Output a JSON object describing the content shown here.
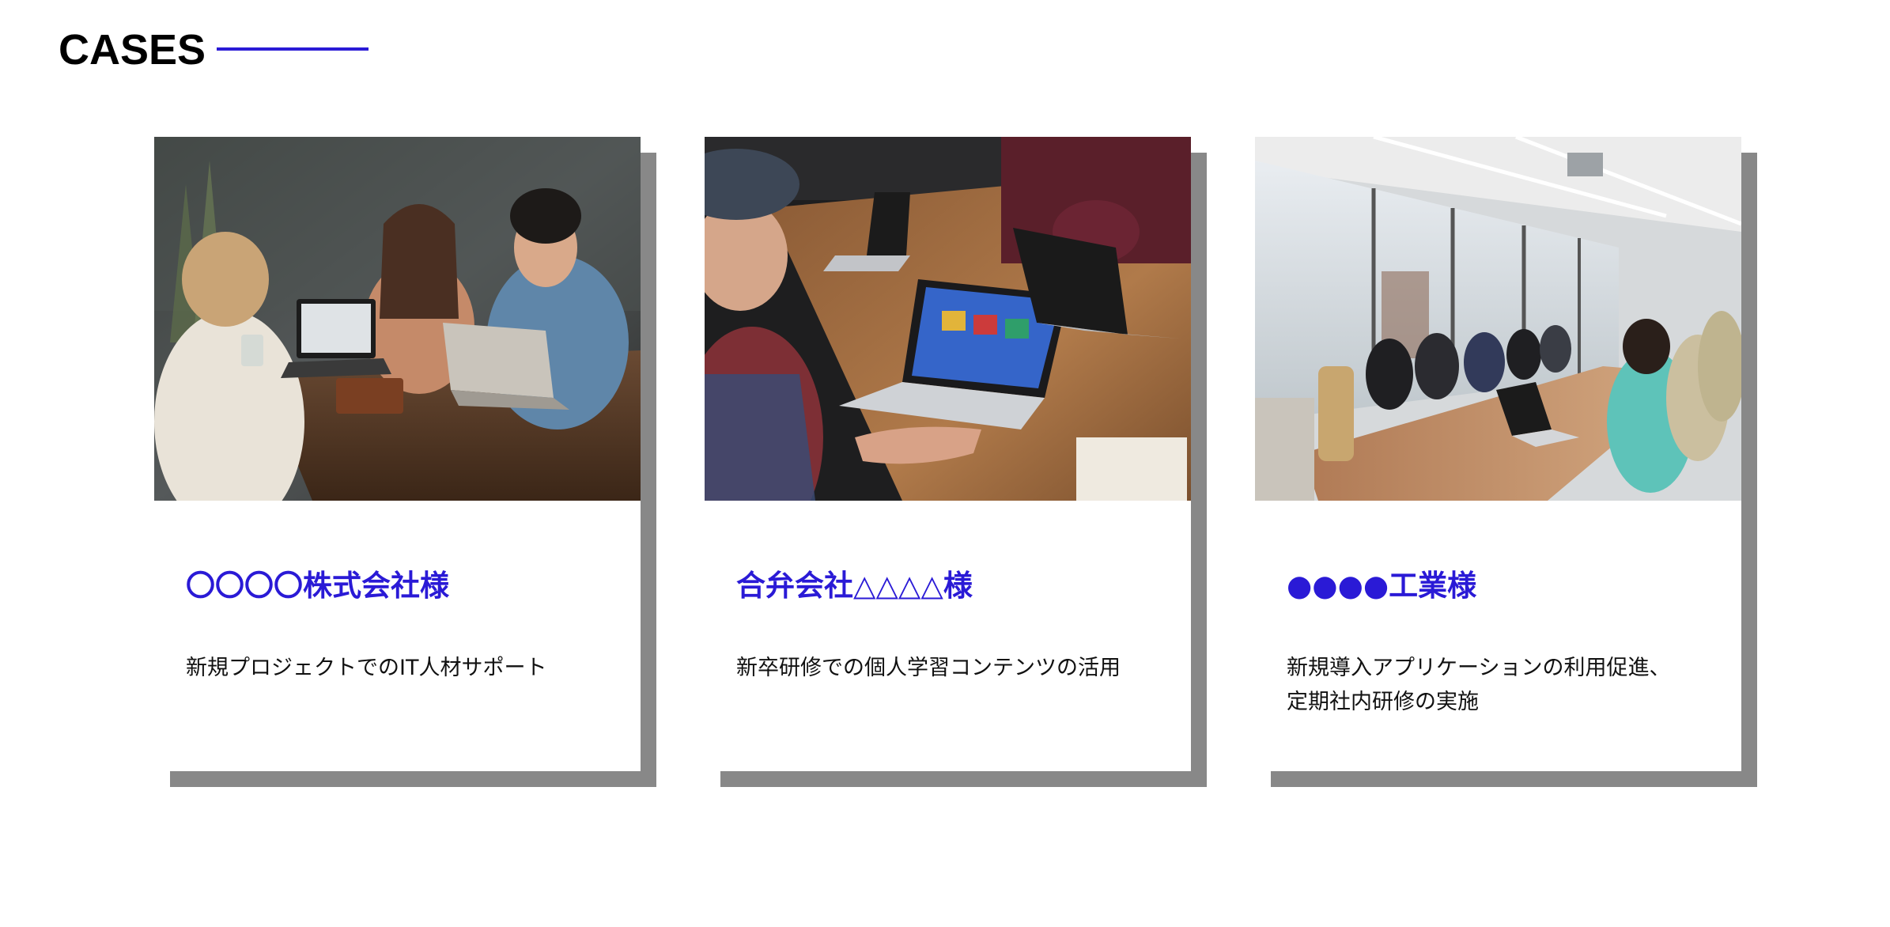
{
  "header": {
    "title": "CASES"
  },
  "theme": {
    "accent": "#2a1ad6",
    "shadow": "#888888"
  },
  "cases": [
    {
      "name": "〇〇〇〇株式会社様",
      "description_lines": [
        "新規プロジェクトでのIT人材サポート"
      ],
      "photo": "people-laughing-at-cafe-table-with-laptops"
    },
    {
      "name": "合弁会社△△△△様",
      "description_lines": [
        "新卒研修での個人学習コンテンツの活用"
      ],
      "photo": "meeting-table-with-laptops-overhead"
    },
    {
      "name": "●●●●工業様",
      "description_lines": [
        "新規導入アプリケーションの利用促進、",
        "定期社内研修の実施"
      ],
      "photo": "large-conference-room-meeting"
    }
  ]
}
